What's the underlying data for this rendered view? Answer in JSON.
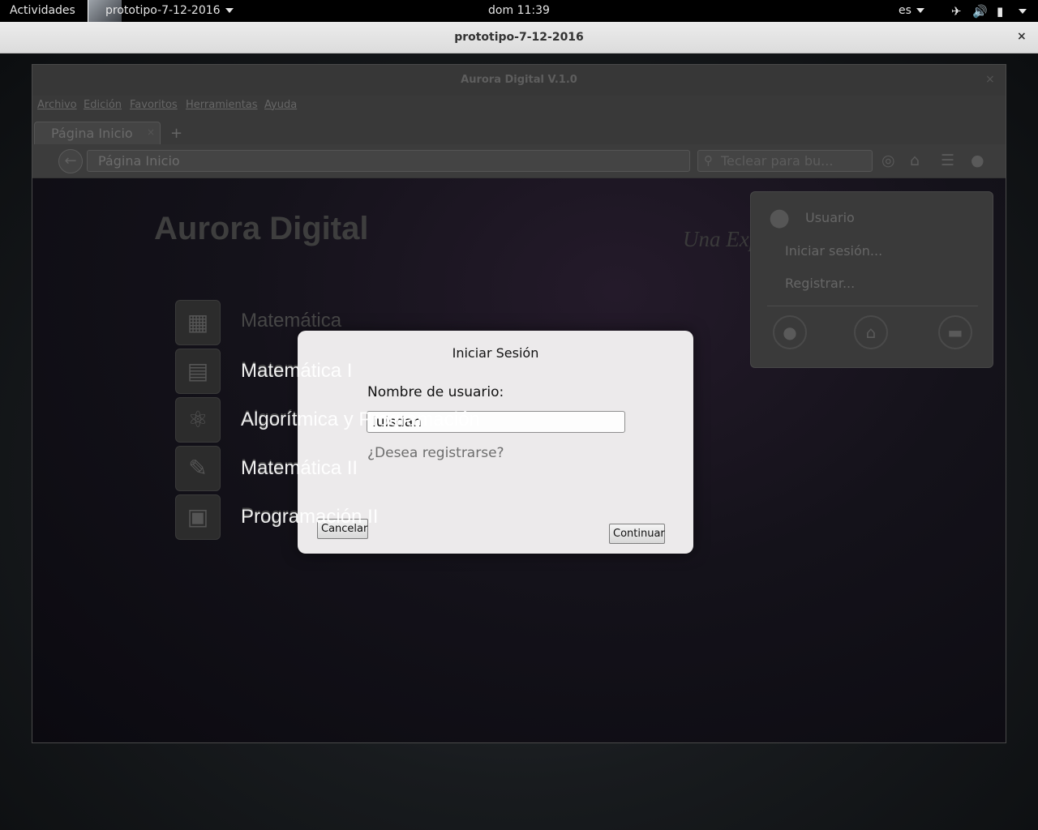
{
  "topbar": {
    "activities": "Actividades",
    "app_menu": "prototipo-7-12-2016",
    "clock": "dom 11:39",
    "language": "es",
    "icons": [
      "airplane-icon",
      "volume-icon",
      "battery-icon",
      "system-menu-caret-icon"
    ]
  },
  "host_window": {
    "title": "prototipo-7-12-2016",
    "close": "×"
  },
  "app_window": {
    "title": "Aurora Digital V.1.0",
    "close": "×",
    "menu": [
      "Archivo",
      "Edición",
      "Favoritos",
      "Herramientas",
      "Ayuda"
    ],
    "tab": {
      "label": "Página Inicio",
      "close": "×"
    },
    "new_tab": "+",
    "url": "Página Inicio",
    "search_placeholder": "Teclear para bu...",
    "nav_icons": [
      "compass-icon",
      "home-icon",
      "list-icon",
      "user-icon"
    ]
  },
  "page": {
    "brand": "Aurora Digital",
    "tagline": "Una Exp",
    "subjects": [
      {
        "label": "Matemática",
        "icon": "calculator-icon"
      },
      {
        "label": "Matemática I",
        "icon": "abacus-icon"
      },
      {
        "label": "Algorítmica y Programación",
        "icon": "atom-icon"
      },
      {
        "label": "Matemática II",
        "icon": "notebook-icon"
      },
      {
        "label": "Programación II",
        "icon": "binary-monitor-icon"
      }
    ]
  },
  "user_popover": {
    "title": "Usuario",
    "items": [
      "Iniciar sesión...",
      "Registrar..."
    ],
    "icons": [
      "user-icon",
      "home-icon",
      "display-icon"
    ]
  },
  "dialog": {
    "title": "Iniciar Sesión",
    "username_label": "Nombre de usuario:",
    "username_value": "luisdan",
    "register_link": "¿Desea registrarse?",
    "cancel": "Cancelar",
    "continue": "Continuar",
    "bleed_text": [
      "Matemática I",
      "Algorítmica y Programación",
      "Matemática II",
      "Programación II"
    ]
  },
  "colors": {
    "topbar_bg": "#000000",
    "dialog_bg": "#eceaeb",
    "dimmed_window": "#242424"
  }
}
